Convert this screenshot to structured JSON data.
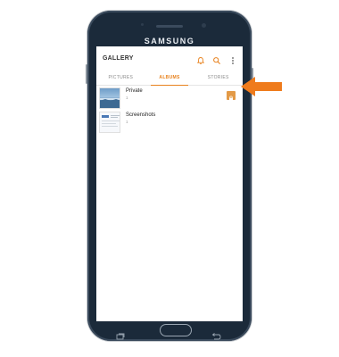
{
  "device": {
    "brand": "SAMSUNG"
  },
  "app": {
    "title": "GALLERY"
  },
  "tabs": [
    {
      "label": "PICTURES",
      "active": false
    },
    {
      "label": "ALBUMS",
      "active": true
    },
    {
      "label": "STORIES",
      "active": false
    }
  ],
  "albums": [
    {
      "name": "Private",
      "count": "1",
      "thumb": "blue-landscape-photo",
      "badge": "lock-icon"
    },
    {
      "name": "Screenshots",
      "count": "1",
      "thumb": "screenshot-preview",
      "badge": null
    }
  ],
  "icons": {
    "notifications": "bell-icon",
    "search": "search-icon",
    "more": "more-vert-icon"
  },
  "colors": {
    "accent": "#e8821e",
    "phone_body": "#1b2a3a",
    "badge": "#e39a47",
    "callout_arrow": "#ef7b1c"
  }
}
